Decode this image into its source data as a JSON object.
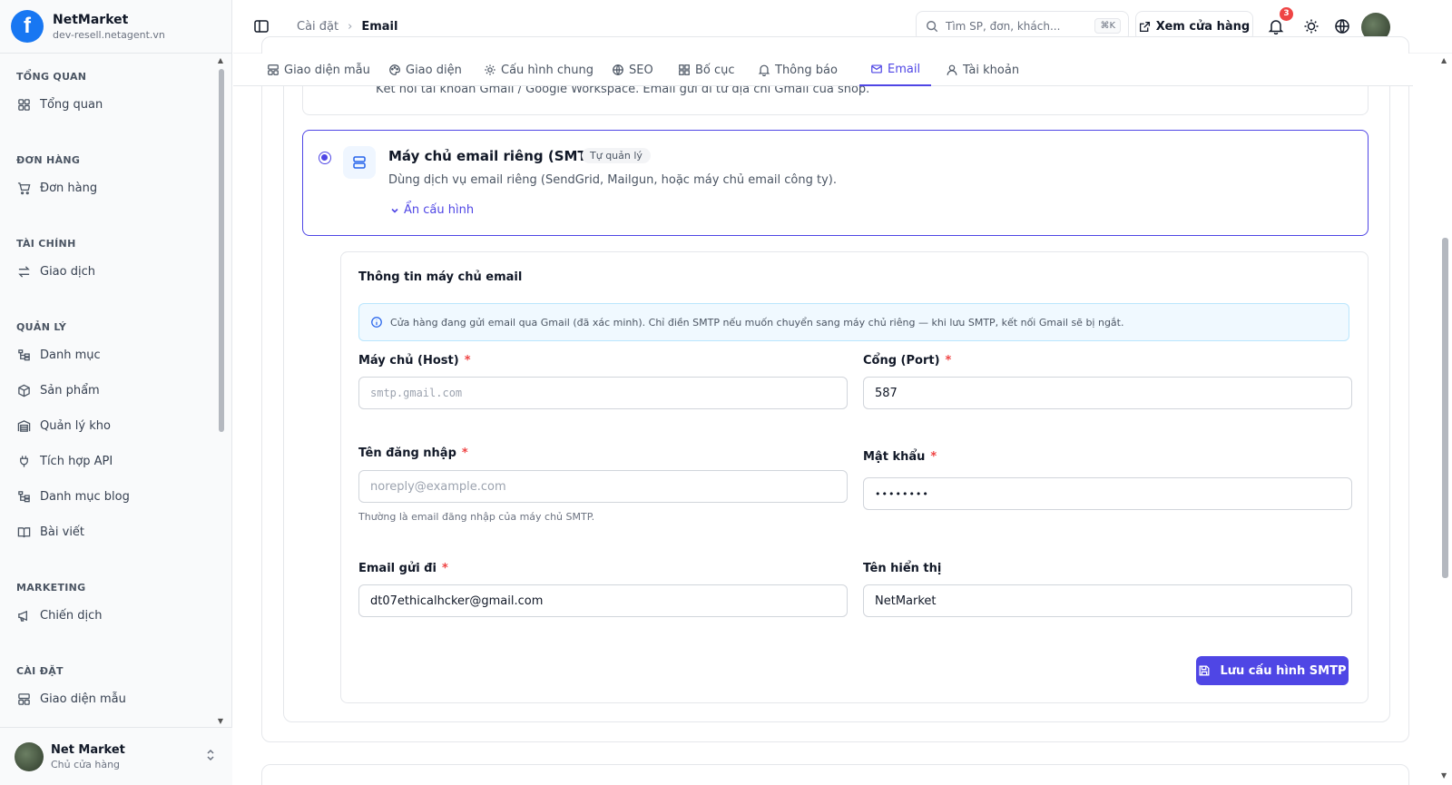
{
  "brand": {
    "name": "NetMarket",
    "domain": "dev-resell.netagent.vn"
  },
  "nav_groups": [
    {
      "title": "TỔNG QUAN",
      "items": [
        {
          "label": "Tổng quan",
          "icon": "grid-icon"
        }
      ]
    },
    {
      "title": "ĐƠN HÀNG",
      "items": [
        {
          "label": "Đơn hàng",
          "icon": "cart-icon"
        }
      ]
    },
    {
      "title": "TÀI CHÍNH",
      "items": [
        {
          "label": "Giao dịch",
          "icon": "arrows-icon"
        }
      ]
    },
    {
      "title": "QUẢN LÝ",
      "items": [
        {
          "label": "Danh mục",
          "icon": "tree-icon"
        },
        {
          "label": "Sản phẩm",
          "icon": "box-icon"
        },
        {
          "label": "Quản lý kho",
          "icon": "warehouse-icon"
        },
        {
          "label": "Tích hợp API",
          "icon": "plug-icon"
        },
        {
          "label": "Danh mục blog",
          "icon": "tree-icon"
        },
        {
          "label": "Bài viết",
          "icon": "book-icon"
        }
      ]
    },
    {
      "title": "MARKETING",
      "items": [
        {
          "label": "Chiến dịch",
          "icon": "megaphone-icon"
        }
      ]
    },
    {
      "title": "CÀI ĐẶT",
      "items": [
        {
          "label": "Giao diện mẫu",
          "icon": "layout-icon"
        }
      ]
    }
  ],
  "user": {
    "name": "Net Market",
    "role": "Chủ cửa hàng"
  },
  "header": {
    "breadcrumb": [
      "Cài đặt",
      "Email"
    ],
    "search_placeholder": "Tìm SP, đơn, khách...",
    "search_shortcut": "⌘K",
    "store_button": "Xem cửa hàng",
    "notification_count": "3"
  },
  "tabs": [
    {
      "label": "Giao diện mẫu",
      "icon": "layout-icon",
      "active": false
    },
    {
      "label": "Giao diện",
      "icon": "palette-icon",
      "active": false
    },
    {
      "label": "Cấu hình chung",
      "icon": "gear-icon",
      "active": false
    },
    {
      "label": "SEO",
      "icon": "globe-icon",
      "active": false
    },
    {
      "label": "Bố cục",
      "icon": "grid-icon",
      "active": false
    },
    {
      "label": "Thông báo",
      "icon": "bell-icon",
      "active": false
    },
    {
      "label": "Email",
      "icon": "mail-icon",
      "active": true
    },
    {
      "label": "Tài khoản",
      "icon": "user-icon",
      "active": false
    }
  ],
  "gmail_option": {
    "description": "Kết nối tài khoản Gmail / Google Workspace. Email gửi đi từ địa chỉ Gmail của shop."
  },
  "smtp_option": {
    "title": "Máy chủ email riêng (SMTP)",
    "badge": "Tự quản lý",
    "description": "Dùng dịch vụ email riêng (SendGrid, Mailgun, hoặc máy chủ email công ty).",
    "toggle_label": "Ẩn cấu hình"
  },
  "config": {
    "title": "Thông tin máy chủ email",
    "info": "Cửa hàng đang gửi email qua Gmail (đã xác minh). Chỉ điền SMTP nếu muốn chuyển sang máy chủ riêng — khi lưu SMTP, kết nối Gmail sẽ bị ngắt.",
    "host": {
      "label": "Máy chủ (Host)",
      "required": "*",
      "value": "",
      "placeholder": "smtp.gmail.com"
    },
    "port": {
      "label": "Cổng (Port)",
      "required": "*",
      "value": "587"
    },
    "username": {
      "label": "Tên đăng nhập",
      "required": "*",
      "value": "",
      "placeholder": "noreply@example.com",
      "hint": "Thường là email đăng nhập của máy chủ SMTP."
    },
    "password": {
      "label": "Mật khẩu",
      "required": "*",
      "value": "••••••••"
    },
    "from_email": {
      "label": "Email gửi đi",
      "required": "*",
      "value": "dt07ethicalhcker@gmail.com"
    },
    "display_name": {
      "label": "Tên hiển thị",
      "value": "NetMarket"
    },
    "save_label": "Lưu cấu hình SMTP"
  },
  "colors": {
    "accent": "#4f46e5",
    "badge": "#ef4444",
    "facebook": "#1877f2",
    "info_bg": "#f0f9ff"
  }
}
